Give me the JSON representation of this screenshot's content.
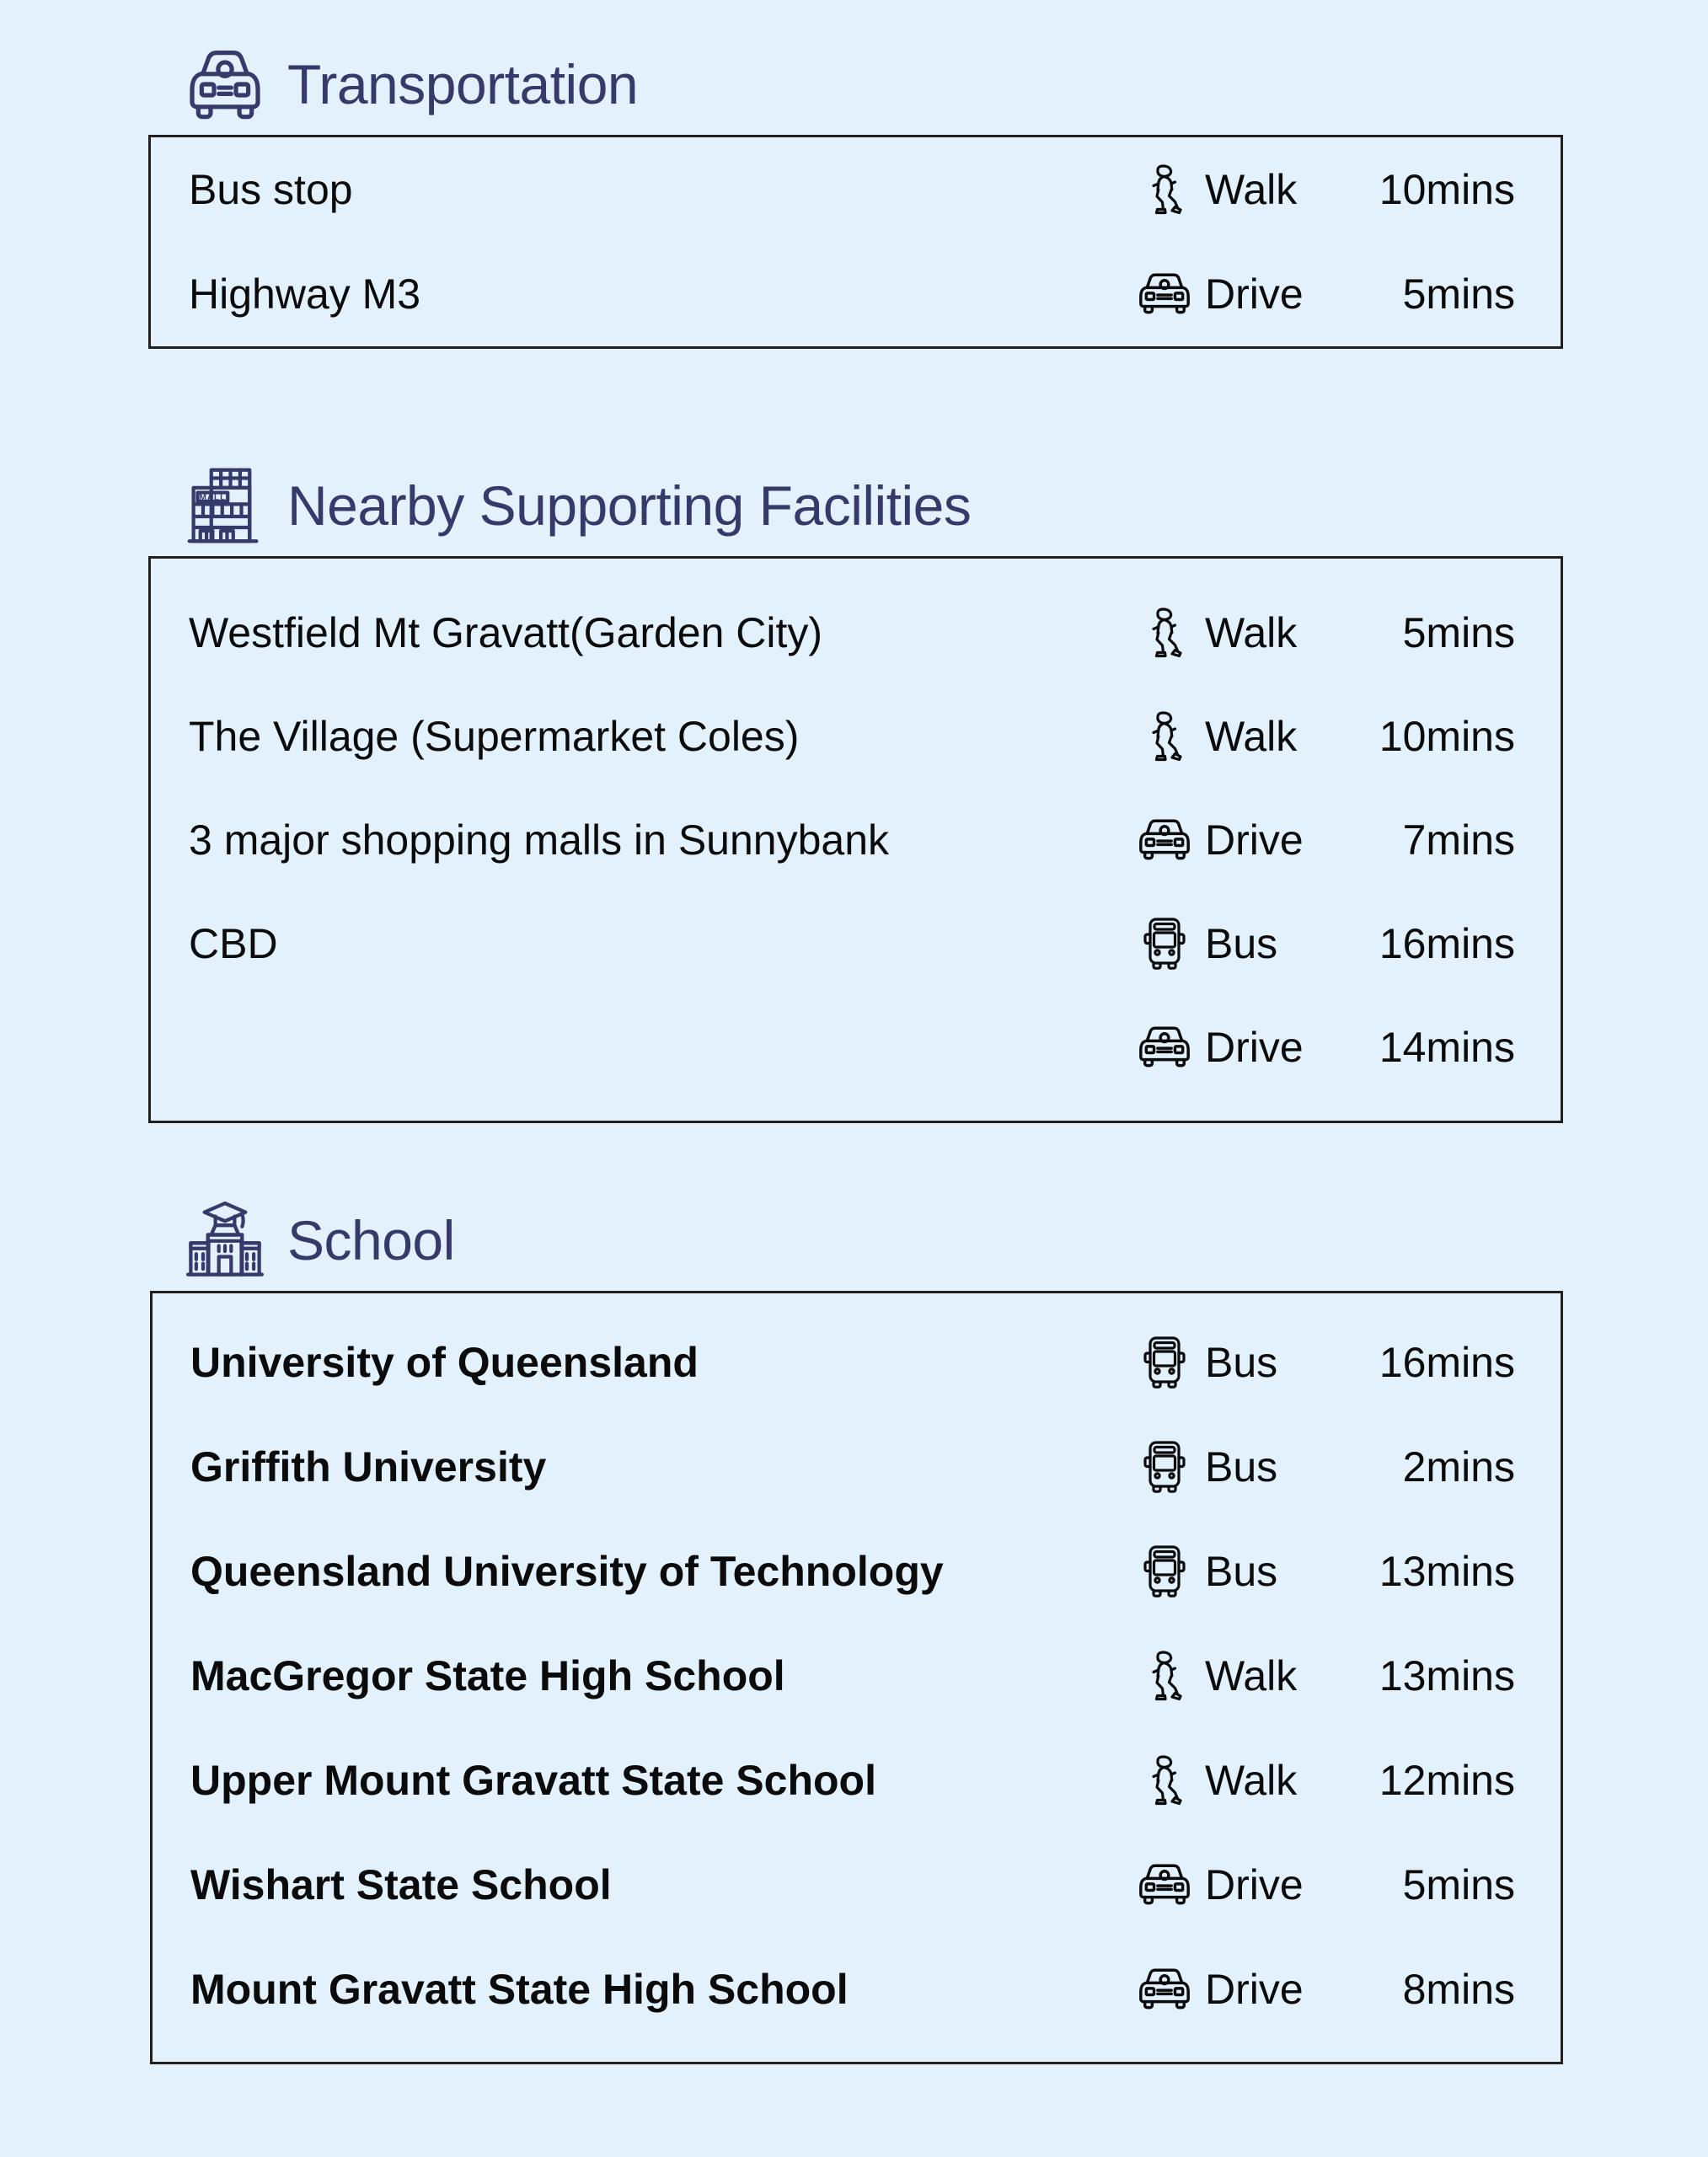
{
  "colors": {
    "background": "#e2f1fc",
    "title": "#363a6b",
    "border": "#231f1d",
    "text": "#0b0b0b"
  },
  "sections": [
    {
      "id": "transportation",
      "title": "Transportation",
      "icon": "car-icon",
      "bold_rows": false,
      "rows": [
        {
          "place": "Bus stop",
          "icon": "walk-icon",
          "mode": "Walk",
          "time": "10mins"
        },
        {
          "place": "Highway M3",
          "icon": "car-icon",
          "mode": "Drive",
          "time": "5mins"
        }
      ]
    },
    {
      "id": "nearby-supporting-facilities",
      "title": "Nearby Supporting Facilities",
      "icon": "mall-icon",
      "bold_rows": false,
      "rows": [
        {
          "place": "Westfield Mt Gravatt(Garden City)",
          "icon": "walk-icon",
          "mode": "Walk",
          "time": "5mins"
        },
        {
          "place": "The Village (Supermarket Coles)",
          "icon": "walk-icon",
          "mode": "Walk",
          "time": "10mins"
        },
        {
          "place": "3 major shopping malls in Sunnybank",
          "icon": "car-icon",
          "mode": "Drive",
          "time": "7mins"
        },
        {
          "place": "CBD",
          "icon": "bus-icon",
          "mode": "Bus",
          "time": "16mins"
        },
        {
          "place": "",
          "icon": "car-icon",
          "mode": "Drive",
          "time": "14mins"
        }
      ]
    },
    {
      "id": "school",
      "title": "School",
      "icon": "school-icon",
      "bold_rows": true,
      "rows": [
        {
          "place": "University of Queensland",
          "icon": "bus-icon",
          "mode": "Bus",
          "time": "16mins"
        },
        {
          "place": "Griffith University",
          "icon": "bus-icon",
          "mode": "Bus",
          "time": "2mins"
        },
        {
          "place": "Queensland University of Technology",
          "icon": "bus-icon",
          "mode": "Bus",
          "time": "13mins"
        },
        {
          "place": "MacGregor State High School",
          "icon": "walk-icon",
          "mode": "Walk",
          "time": "13mins"
        },
        {
          "place": "Upper Mount Gravatt State School",
          "icon": "walk-icon",
          "mode": "Walk",
          "time": "12mins"
        },
        {
          "place": "Wishart State School",
          "icon": "car-icon",
          "mode": "Drive",
          "time": "5mins"
        },
        {
          "place": "Mount Gravatt State High School",
          "icon": "car-icon",
          "mode": "Drive",
          "time": "8mins"
        }
      ]
    }
  ],
  "mall_icon_label": "MALL"
}
